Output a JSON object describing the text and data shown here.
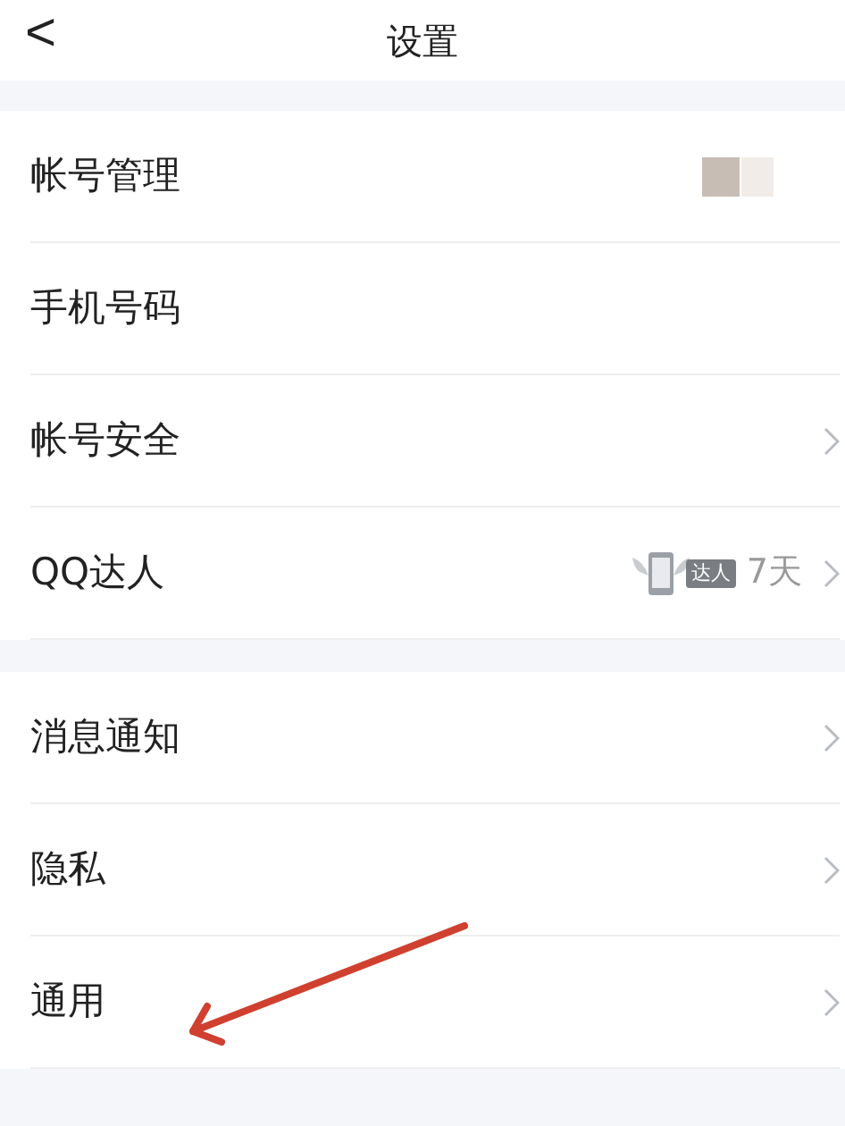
{
  "header": {
    "back": "<",
    "title": "设置"
  },
  "groups": [
    {
      "rows": [
        {
          "kind": "avatar",
          "label": "帐号管理",
          "chevron": false
        },
        {
          "kind": "plain",
          "label": "手机号码",
          "chevron": false
        },
        {
          "kind": "plain",
          "label": "帐号安全",
          "chevron": true
        },
        {
          "kind": "badge",
          "label": "QQ达人",
          "badge": "达人",
          "value": "7天",
          "chevron": true
        }
      ]
    },
    {
      "rows": [
        {
          "kind": "plain",
          "label": "消息通知",
          "chevron": true
        },
        {
          "kind": "plain",
          "label": "隐私",
          "chevron": true
        },
        {
          "kind": "plain",
          "label": "通用",
          "chevron": true
        }
      ]
    }
  ]
}
